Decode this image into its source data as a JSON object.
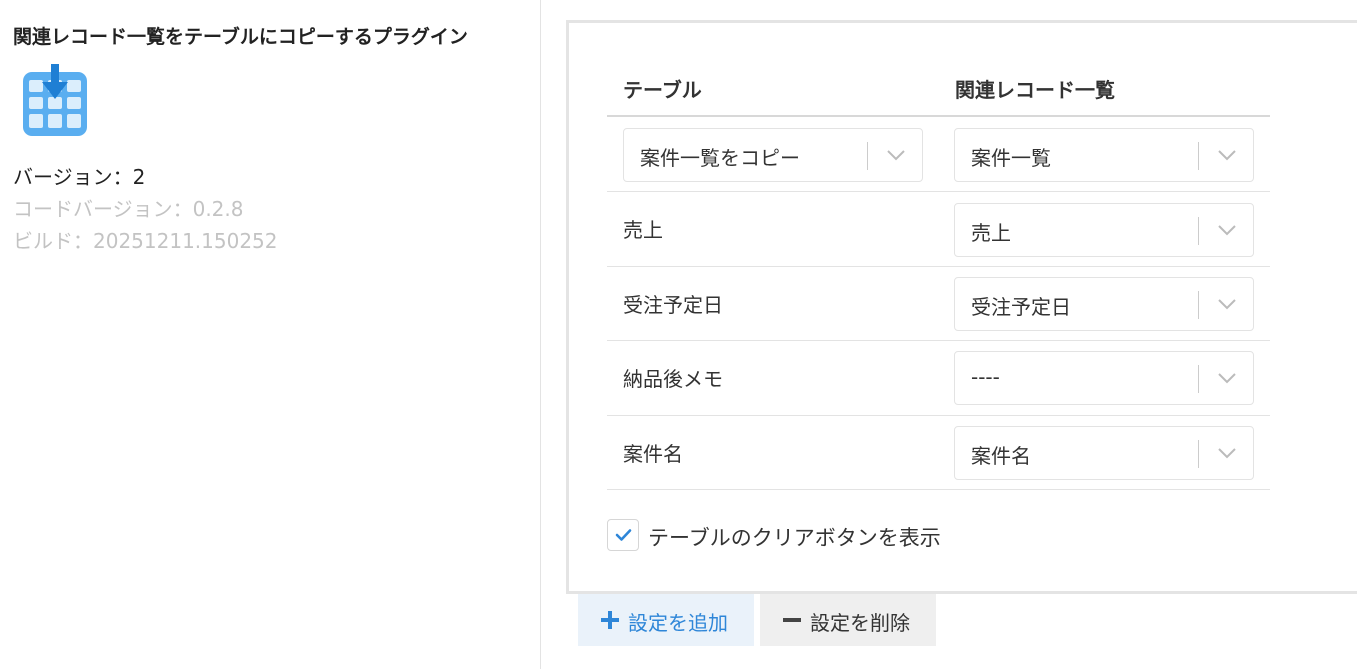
{
  "plugin": {
    "title": "関連レコード一覧をテーブルにコピーするプラグイン",
    "icon": "table-download-icon",
    "version": "バージョン：2",
    "code_version": "コードバージョン：0.2.8",
    "build": "ビルド：20251211.150252"
  },
  "mapping": {
    "headers": {
      "table": "テーブル",
      "related": "関連レコード一覧"
    },
    "source_select": {
      "table_value": "案件一覧をコピー",
      "related_value": "案件一覧"
    },
    "rows": [
      {
        "label": "売上",
        "value": "売上"
      },
      {
        "label": "受注予定日",
        "value": "受注予定日"
      },
      {
        "label": "納品後メモ",
        "value": "----"
      },
      {
        "label": "案件名",
        "value": "案件名"
      }
    ]
  },
  "options": {
    "show_clear_button": {
      "label": "テーブルのクリアボタンを表示",
      "checked": true
    }
  },
  "actions": {
    "add_label": "設定を追加",
    "delete_label": "設定を削除"
  },
  "colors": {
    "accent": "#2e86d8",
    "icon_blue": "#5aaef0",
    "muted_text": "#c3c3c3"
  }
}
